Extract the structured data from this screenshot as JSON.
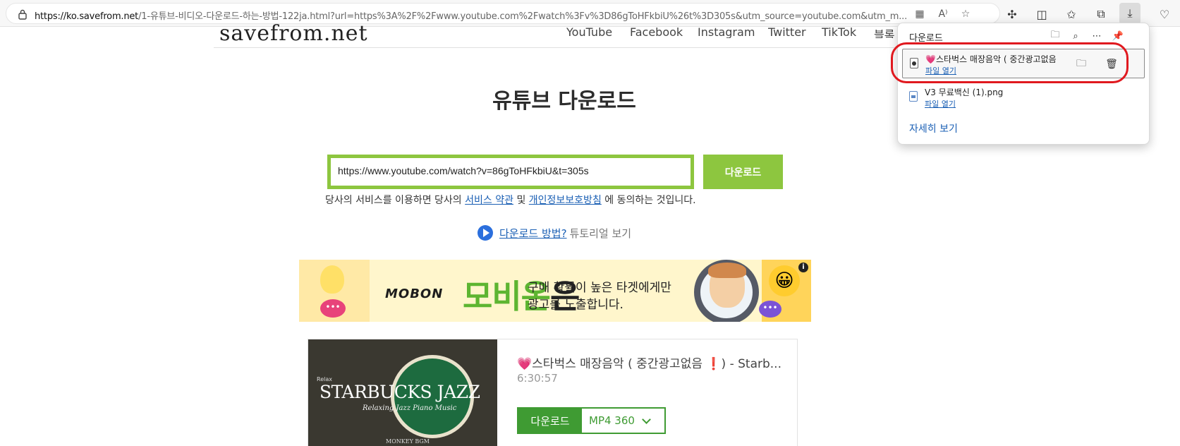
{
  "browser": {
    "url_host": "https://ko.savefrom.net",
    "url_rest": "/1-유튜브-비디오-다운로드-하는-방법-122ja.html?url=https%3A%2F%2Fwww.youtube.com%2Fwatch%3Fv%3D86gToHFkbiU%26t%3D305s&utm_source=youtube.com&utm_m...",
    "reader_label": "A⁾"
  },
  "site": {
    "logo": "savefrom.net",
    "nav": [
      "YouTube",
      "Facebook",
      "Instagram",
      "Twitter",
      "TikTok",
      "블록"
    ]
  },
  "main": {
    "title": "유튜브 다운로드",
    "input_value": "https://www.youtube.com/watch?v=86gToHFkbiU&t=305s",
    "download_button": "다운로드",
    "terms_prefix": "당사의 서비스를 이용하면 당사의",
    "terms_link1": "서비스 약관",
    "terms_mid": "및",
    "terms_link2": "개인정보보호방침",
    "terms_suffix": "에 동의하는 것입니다.",
    "howto_link": "다운로드 방법?",
    "howto_text": "튜토리얼 보기"
  },
  "ad": {
    "brand_logo": "MOBON",
    "brand_big": "모비온",
    "brand_big_suffix": "은",
    "copy_line1": "구매 확률이 높은 타겟에게만",
    "copy_line2": "광고를 노출합니다.",
    "bubble_text": "•••",
    "info_label": "i"
  },
  "result": {
    "title": "💗스타벅스 매장음악 ( 중간광고없음 ❗) - Starb...",
    "duration": "6:30:57",
    "thumb_title": "STARBUCKS JAZZ",
    "thumb_subtitle": "Relaxing Jazz Piano Music",
    "thumb_small": "MONKEY BGM",
    "thumb_corner": "Relax",
    "download_label": "다운로드",
    "format": "MP4  360"
  },
  "downloads_panel": {
    "title": "다운로드",
    "items": [
      {
        "name": "💗스타벅스 매장음악 ( 중간광고없음",
        "action": "파일 열기"
      },
      {
        "name": "V3 무료백신 (1).png",
        "action": "파일 열기"
      }
    ],
    "more_link": "자세히 보기"
  },
  "colors": {
    "accent_green": "#8dc63f",
    "dark_green": "#3f9b33",
    "link_blue": "#1a5fb4",
    "highlight_red": "#e0191f"
  }
}
